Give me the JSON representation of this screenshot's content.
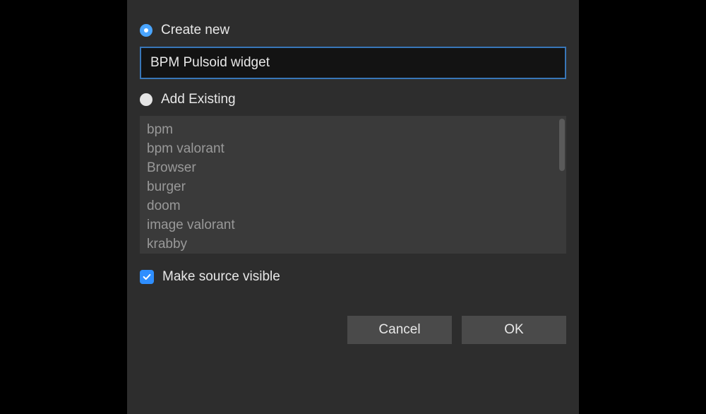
{
  "mode": {
    "create_new_label": "Create new",
    "add_existing_label": "Add Existing"
  },
  "name_input": {
    "value": "BPM Pulsoid widget"
  },
  "existing_items": [
    "bpm",
    "bpm valorant",
    "Browser",
    "burger",
    "doom",
    "image valorant",
    "krabby"
  ],
  "visibility": {
    "label": "Make source visible"
  },
  "buttons": {
    "cancel": "Cancel",
    "ok": "OK"
  }
}
